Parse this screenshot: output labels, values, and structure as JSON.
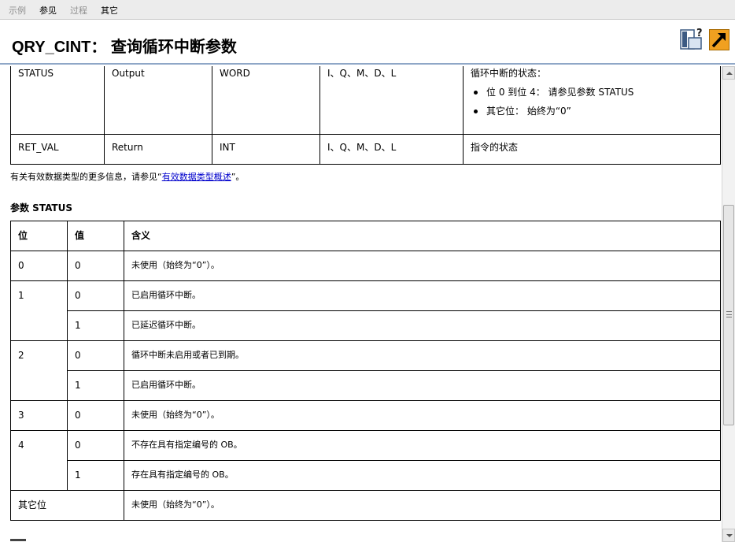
{
  "tabs": [
    {
      "label": "示例",
      "enabled": false
    },
    {
      "label": "参见",
      "enabled": true
    },
    {
      "label": "过程",
      "enabled": false
    },
    {
      "label": "其它",
      "enabled": true
    }
  ],
  "header": {
    "title": "QRY_CINT： 查询循环中断参数",
    "icons": [
      "help-window-icon",
      "jump-arrow-icon"
    ]
  },
  "param_table": {
    "rows": [
      {
        "name": "STATUS",
        "declaration": "Output",
        "data_type": "WORD",
        "memory_area": "I、Q、M、D、L",
        "description": "循环中断的状态：",
        "bullets": [
          "位 0 到位 4： 请参见参数 STATUS",
          "其它位： 始终为“0”"
        ]
      },
      {
        "name": "RET_VAL",
        "declaration": "Return",
        "data_type": "INT",
        "memory_area": "I、Q、M、D、L",
        "description": "指令的状态",
        "bullets": []
      }
    ]
  },
  "note": {
    "prefix": "有关有效数据类型的更多信息，请参见“",
    "link": "有效数据类型概述",
    "suffix": "”。"
  },
  "status_section": {
    "title": "参数 STATUS",
    "headers": [
      "位",
      "值",
      "含义"
    ],
    "rows": {
      "r0": {
        "bit": "0",
        "value": "0",
        "meaning": "未使用（始终为“0”）。"
      },
      "r1a": {
        "bit": "1",
        "value": "0",
        "meaning": "已启用循环中断。"
      },
      "r1b": {
        "value": "1",
        "meaning": "已延迟循环中断。"
      },
      "r2a": {
        "bit": "2",
        "value": "0",
        "meaning": "循环中断未启用或者已到期。"
      },
      "r2b": {
        "value": "1",
        "meaning": "已启用循环中断。"
      },
      "r3": {
        "bit": "3",
        "value": "0",
        "meaning": "未使用（始终为“0”）。"
      },
      "r4a": {
        "bit": "4",
        "value": "0",
        "meaning": "不存在具有指定编号的 OB。"
      },
      "r4b": {
        "value": "1",
        "meaning": "存在具有指定编号的 OB。"
      },
      "other": {
        "bit": "其它位",
        "meaning": "未使用（始终为“0”）。"
      }
    }
  },
  "colors": {
    "header_rule": "#8fa7c7",
    "link": "#0000cc",
    "toolbar_bg": "#ececec",
    "disabled_tab": "#8f8f8f",
    "arrow_icon": "#f0a020"
  }
}
